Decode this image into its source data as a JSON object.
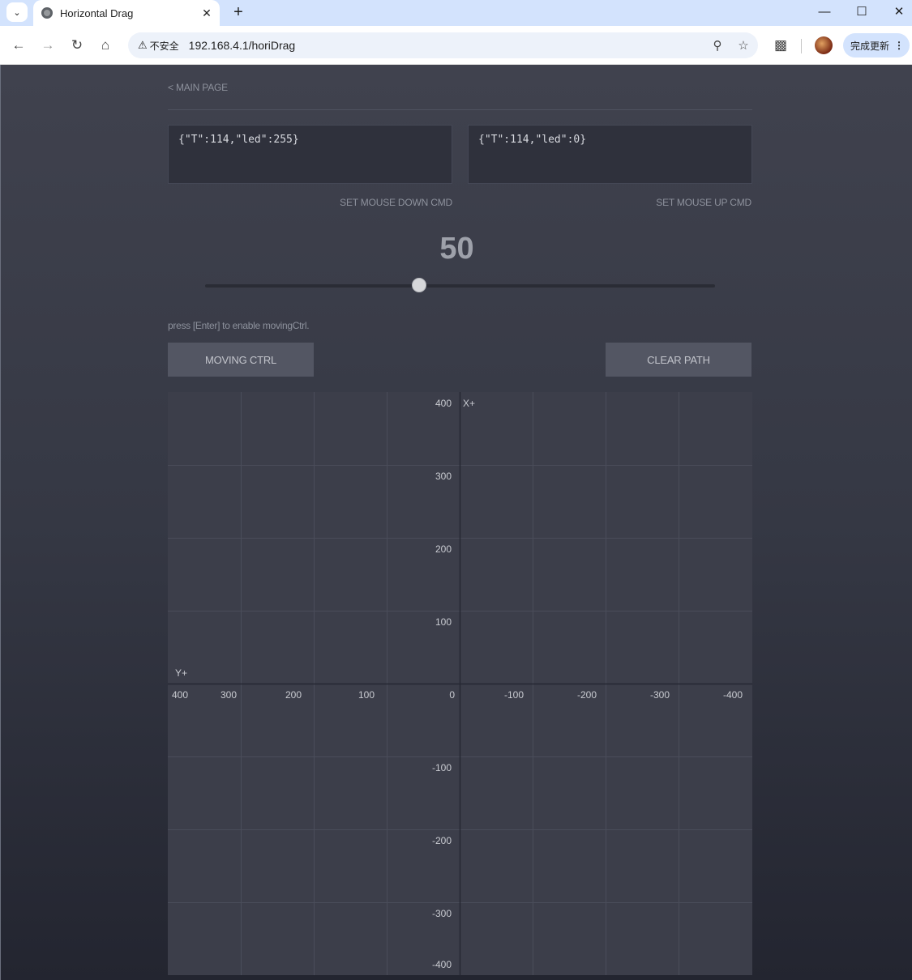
{
  "browser": {
    "tab_title": "Horizontal Drag",
    "security_label": "不安全",
    "url": "192.168.4.1/horiDrag",
    "update_label": "完成更新"
  },
  "page": {
    "main_link": "< MAIN PAGE",
    "mouse_down_cmd": "{\"T\":114,\"led\":255}",
    "mouse_up_cmd": "{\"T\":114,\"led\":0}",
    "mouse_down_label": "SET MOUSE DOWN CMD",
    "mouse_up_label": "SET MOUSE UP CMD",
    "slider_value": "50",
    "slider_fraction": 0.42,
    "hint": "press [Enter] to enable movingCtrl.",
    "moving_ctrl_label": "MOVING CTRL",
    "clear_path_label": "CLEAR PATH"
  },
  "grid": {
    "x_axis_label": "X+",
    "y_axis_label": "Y+",
    "vertical_labels": [
      "400",
      "300",
      "200",
      "100",
      "-100",
      "-200",
      "-300",
      "-400"
    ],
    "horizontal_labels": [
      "400",
      "300",
      "200",
      "100",
      "0",
      "-100",
      "-200",
      "-300",
      "-400"
    ]
  },
  "colors": {
    "page_bg_top": "#40424e",
    "page_bg_bottom": "#232530",
    "grid_bg": "#3c3e4a",
    "button_bg": "#535663"
  }
}
